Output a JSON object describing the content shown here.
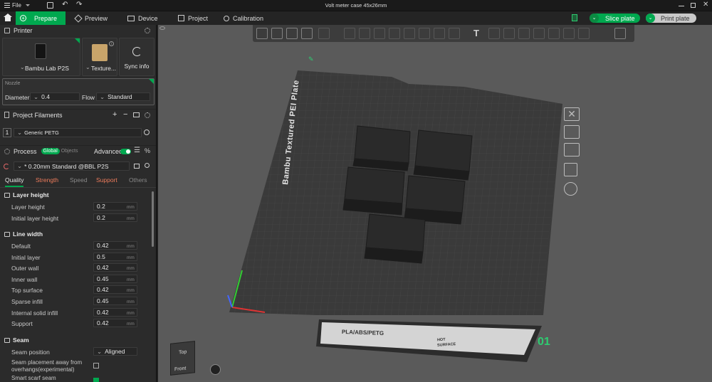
{
  "titlebar": {
    "menu_label": "File",
    "window_title": "Volt meter case 45x26mm"
  },
  "tabs": [
    {
      "label": "Prepare",
      "active": true,
      "icon": "plus-circle-icon"
    },
    {
      "label": "Preview",
      "active": false,
      "icon": "cube-icon"
    },
    {
      "label": "Device",
      "active": false,
      "icon": "device-icon"
    },
    {
      "label": "Project",
      "active": false,
      "icon": "project-icon"
    },
    {
      "label": "Calibration",
      "active": false,
      "icon": "target-icon"
    }
  ],
  "actions": {
    "slice_label": "Slice plate",
    "print_label": "Print plate"
  },
  "printer": {
    "section_title": "Printer",
    "name": "Bambu Lab P2S",
    "plate": "Texture...",
    "sync_label": "Sync info",
    "nozzle_title": "Nozzle",
    "diameter_label": "Diameter",
    "diameter_value": "0.4",
    "flow_label": "Flow",
    "flow_value": "Standard"
  },
  "filaments": {
    "section_title": "Project Filaments",
    "items": [
      {
        "index": "1",
        "name": "Generic PETG"
      }
    ]
  },
  "process": {
    "section_title": "Process",
    "toggle_global": "Global",
    "toggle_objects": "Objects",
    "advanced_label": "Advanced",
    "preset": "* 0.20mm Standard @BBL P2S",
    "subtabs": [
      "Quality",
      "Strength",
      "Speed",
      "Support",
      "Others"
    ],
    "groups": {
      "layer_height": {
        "title": "Layer height",
        "rows": [
          {
            "label": "Layer height",
            "value": "0.2",
            "unit": "mm"
          },
          {
            "label": "Initial layer height",
            "value": "0.2",
            "unit": "mm"
          }
        ]
      },
      "line_width": {
        "title": "Line width",
        "rows": [
          {
            "label": "Default",
            "value": "0.42",
            "unit": "mm"
          },
          {
            "label": "Initial layer",
            "value": "0.5",
            "unit": "mm"
          },
          {
            "label": "Outer wall",
            "value": "0.42",
            "unit": "mm"
          },
          {
            "label": "Inner wall",
            "value": "0.45",
            "unit": "mm"
          },
          {
            "label": "Top surface",
            "value": "0.42",
            "unit": "mm"
          },
          {
            "label": "Sparse infill",
            "value": "0.45",
            "unit": "mm"
          },
          {
            "label": "Internal solid infill",
            "value": "0.42",
            "unit": "mm"
          },
          {
            "label": "Support",
            "value": "0.42",
            "unit": "mm"
          }
        ]
      },
      "seam": {
        "title": "Seam",
        "position_label": "Seam position",
        "position_value": "Aligned",
        "overhang_label_1": "Seam placement away from",
        "overhang_label_2": "overhangs(experimental)",
        "scarf_label": "Smart scarf seam"
      }
    }
  },
  "viewport": {
    "plate_text": "Bambu Textured PEI Plate",
    "plate_label": "PLA/ABS/PETG",
    "hot_label_1": "HOT",
    "hot_label_2": "SURFACE",
    "plate_number": "01",
    "cube_top": "Top",
    "cube_front": "Front"
  },
  "colors": {
    "accent": "#00a84f",
    "bed": "#3a3a3a",
    "viewport": "#5a5a5a"
  }
}
